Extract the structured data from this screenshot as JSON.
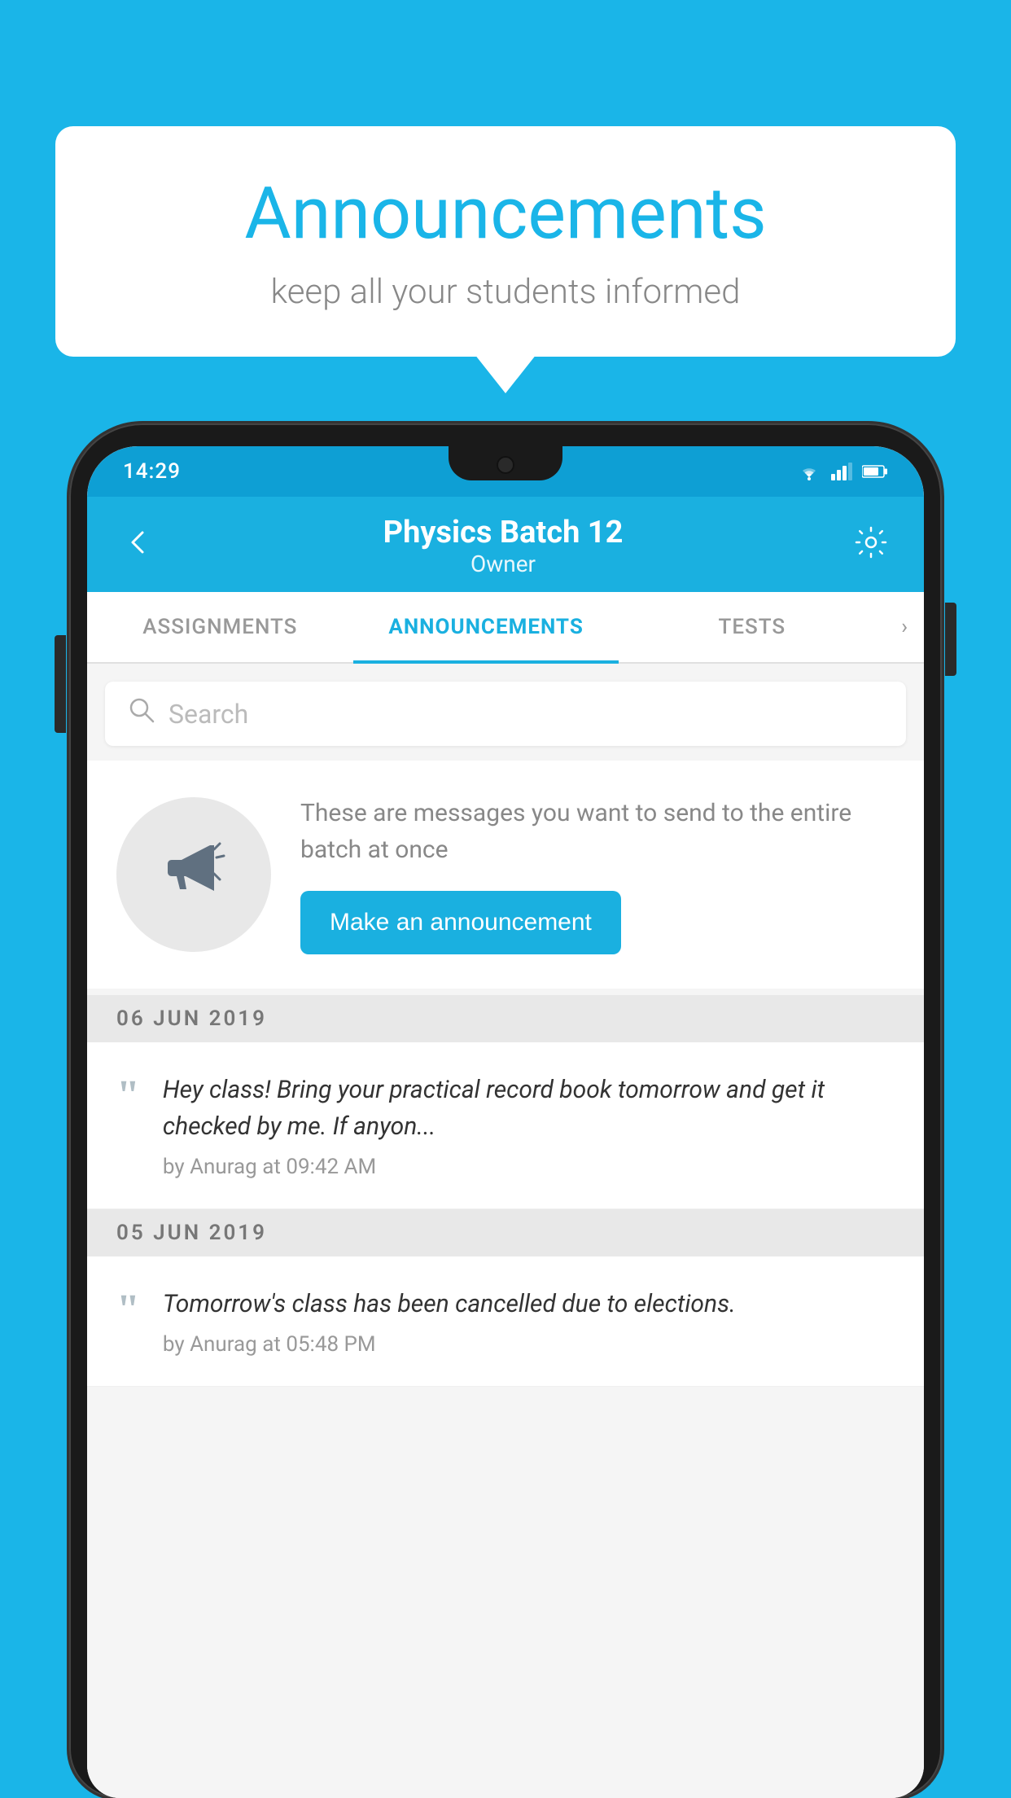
{
  "background": {
    "color": "#1ab5e8"
  },
  "speech_bubble": {
    "title": "Announcements",
    "subtitle": "keep all your students informed"
  },
  "phone": {
    "status_bar": {
      "time": "14:29"
    },
    "header": {
      "title": "Physics Batch 12",
      "subtitle": "Owner",
      "back_label": "←"
    },
    "tabs": [
      {
        "label": "ASSIGNMENTS",
        "active": false
      },
      {
        "label": "ANNOUNCEMENTS",
        "active": true
      },
      {
        "label": "TESTS",
        "active": false
      }
    ],
    "search": {
      "placeholder": "Search"
    },
    "promo_card": {
      "description": "These are messages you want to send to the entire batch at once",
      "button_label": "Make an announcement"
    },
    "announcements": [
      {
        "date_label": "06  JUN  2019",
        "text": "Hey class! Bring your practical record book tomorrow and get it checked by me. If anyon...",
        "meta": "by Anurag at 09:42 AM"
      },
      {
        "date_label": "05  JUN  2019",
        "text": "Tomorrow's class has been cancelled due to elections.",
        "meta": "by Anurag at 05:48 PM"
      }
    ]
  }
}
